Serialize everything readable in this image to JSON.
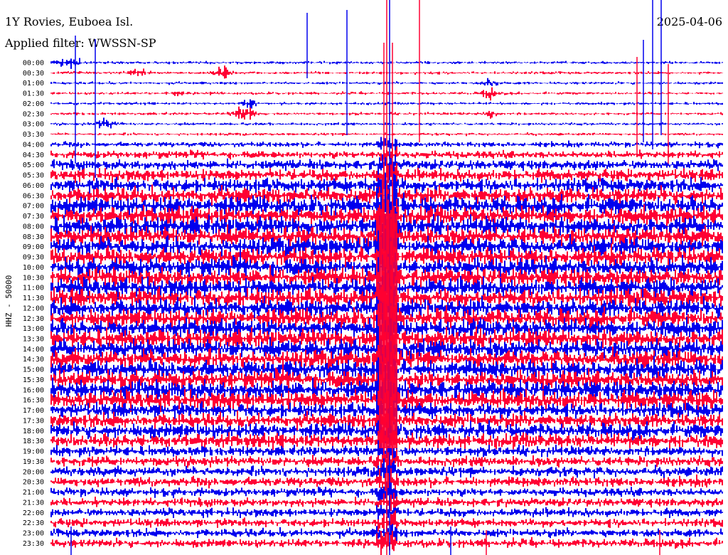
{
  "header": {
    "station": "1Y Rovies, Euboea Isl.",
    "date": "2025-04-06",
    "filter": "Applied filter: WWSSN-SP"
  },
  "chart_data": {
    "type": "line",
    "title": "1Y Rovies, Euboea Isl.",
    "subtitle": "Applied filter: WWSSN-SP",
    "ylabel": "HHZ - 50000",
    "rows": [
      "00:00",
      "00:30",
      "01:00",
      "01:30",
      "02:00",
      "02:30",
      "03:00",
      "03:30",
      "04:00",
      "04:30",
      "05:00",
      "05:30",
      "06:00",
      "06:30",
      "07:00",
      "07:30",
      "08:00",
      "08:30",
      "09:00",
      "09:30",
      "10:00",
      "10:30",
      "11:00",
      "11:30",
      "12:00",
      "12:30",
      "13:00",
      "13:30",
      "14:00",
      "14:30",
      "15:00",
      "15:30",
      "16:00",
      "16:30",
      "17:00",
      "17:30",
      "18:00",
      "18:30",
      "19:00",
      "19:30",
      "20:00",
      "20:30",
      "21:00",
      "21:30",
      "22:00",
      "22:30",
      "23:00",
      "23:30"
    ],
    "trace_colors": [
      "#0000ee",
      "#ff0033"
    ],
    "amplitude_scale": "HHZ - 50000",
    "grid": false
  }
}
